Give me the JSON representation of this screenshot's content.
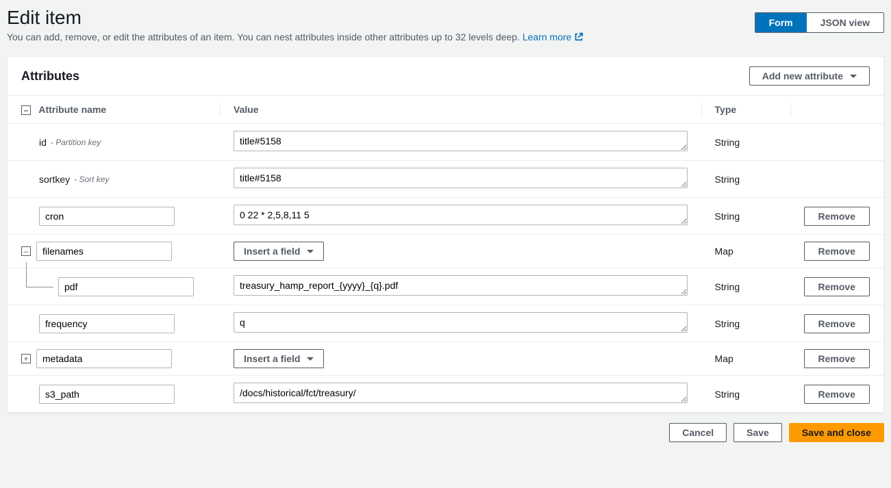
{
  "header": {
    "title": "Edit item",
    "subtitle": "You can add, remove, or edit the attributes of an item. You can nest attributes inside other attributes up to 32 levels deep. ",
    "learn_more": "Learn more"
  },
  "view_toggle": {
    "form": "Form",
    "json": "JSON view"
  },
  "panel": {
    "title": "Attributes",
    "add_button": "Add new attribute"
  },
  "columns": {
    "name": "Attribute name",
    "value": "Value",
    "type": "Type"
  },
  "labels": {
    "remove": "Remove",
    "insert_field": "Insert a field",
    "partition_key": "- Partition key",
    "sort_key": "- Sort key"
  },
  "rows": {
    "id": {
      "name": "id",
      "value": "title#5158",
      "type": "String"
    },
    "sortkey": {
      "name": "sortkey",
      "value": "title#5158",
      "type": "String"
    },
    "cron": {
      "name": "cron",
      "value": "0 22 * 2,5,8,11 5",
      "type": "String"
    },
    "filenames": {
      "name": "filenames",
      "type": "Map"
    },
    "pdf": {
      "name": "pdf",
      "value": "treasury_hamp_report_{yyyy}_{q}.pdf",
      "type": "String"
    },
    "frequency": {
      "name": "frequency",
      "value": "q",
      "type": "String"
    },
    "metadata": {
      "name": "metadata",
      "type": "Map"
    },
    "s3_path": {
      "name": "s3_path",
      "value": "/docs/historical/fct/treasury/",
      "type": "String"
    }
  },
  "footer": {
    "cancel": "Cancel",
    "save": "Save",
    "save_close": "Save and close"
  }
}
